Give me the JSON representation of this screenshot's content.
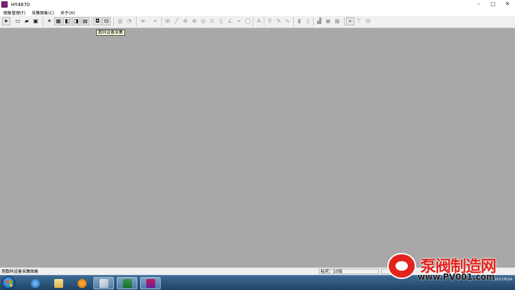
{
  "window": {
    "title": "HY4670"
  },
  "menu": {
    "items": [
      {
        "label": "图象管理(F)"
      },
      {
        "label": "采集图象(C)"
      },
      {
        "label": "关于(H)"
      }
    ]
  },
  "toolbar": {
    "tooltip": "数码设备采集",
    "buttons": [
      {
        "icon": "tool-arrow-icon"
      },
      {
        "icon": "new-file-icon"
      },
      {
        "icon": "open-folder-icon"
      },
      {
        "icon": "save-icon"
      },
      {
        "icon": "wand-icon"
      },
      {
        "icon": "image-grid-icon"
      },
      {
        "icon": "image-adjust-icon"
      },
      {
        "icon": "image-compare-icon"
      },
      {
        "icon": "film-icon"
      },
      {
        "icon": "camera-icon"
      },
      {
        "icon": "digital-capture-icon"
      }
    ]
  },
  "status": {
    "text": "用数码设备采集图象",
    "zoom": "标尺：10倍"
  },
  "taskbar": {
    "clock": "2017/6/14"
  },
  "watermark": {
    "title": "泵阀制造网",
    "url": "www.PV001.com"
  },
  "colors": {
    "workspace": "#a8a8a8",
    "toolbar": "#f0f0f0",
    "watermark_red": "#e3241d"
  }
}
